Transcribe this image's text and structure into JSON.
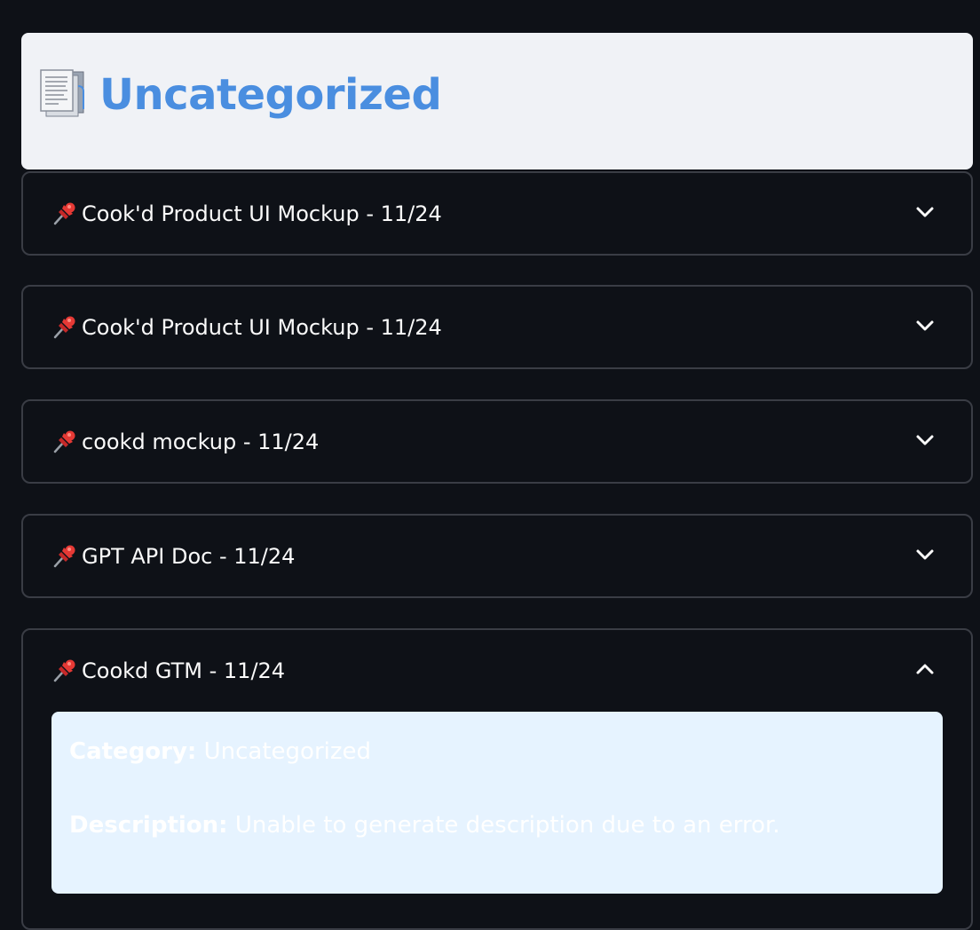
{
  "header": {
    "icon": "document-icon",
    "title": "Uncategorized"
  },
  "expanders": [
    {
      "icon": "pushpin-icon",
      "title": "Cook'd Product UI Mockup - 11/24",
      "expanded": false
    },
    {
      "icon": "pushpin-icon",
      "title": "Cook'd Product UI Mockup - 11/24",
      "expanded": false
    },
    {
      "icon": "pushpin-icon",
      "title": "cookd mockup - 11/24",
      "expanded": false
    },
    {
      "icon": "pushpin-icon",
      "title": "GPT API Doc - 11/24",
      "expanded": false
    },
    {
      "icon": "pushpin-icon",
      "title": "Cookd GTM - 11/24",
      "expanded": true,
      "details": {
        "category_label": "Category:",
        "category_value": "Uncategorized",
        "description_label": "Description:",
        "description_value": "Unable to generate description due to an error."
      }
    }
  ],
  "colors": {
    "background": "#0e1117",
    "header_card": "#f0f2f6",
    "title": "#4a8ee0",
    "info_box": "#e6f3ff",
    "border": "#3a3d45",
    "pin": "#d92b2b"
  }
}
